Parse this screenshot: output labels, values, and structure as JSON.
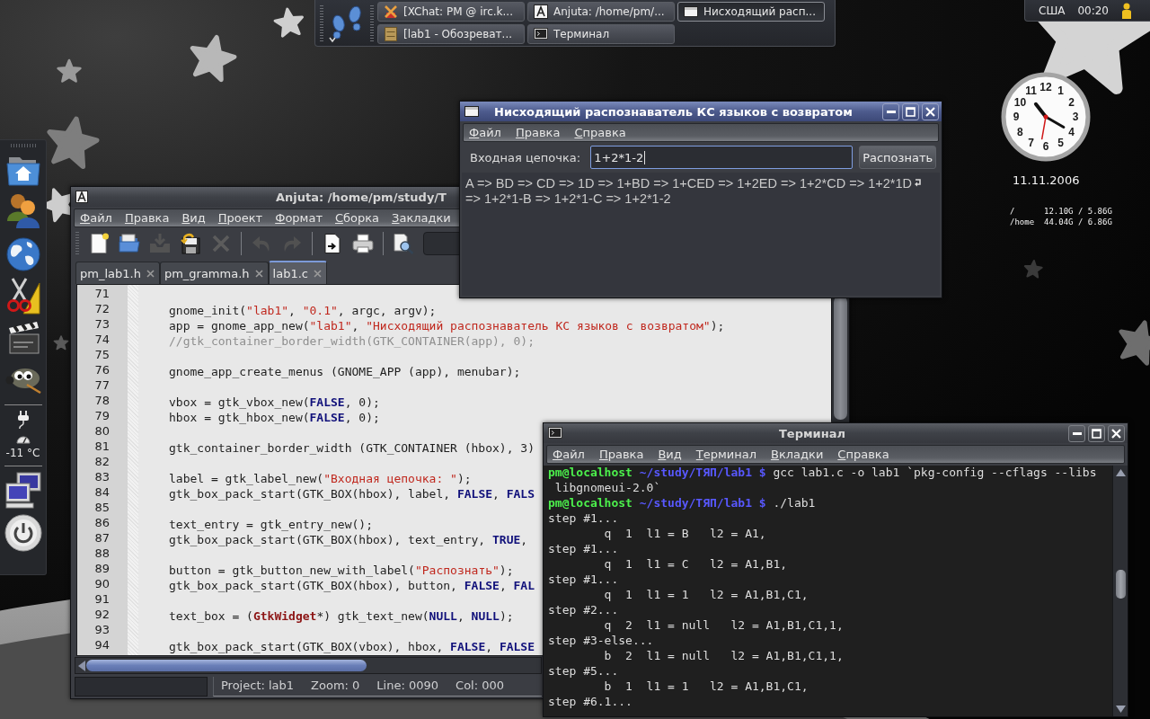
{
  "top_panel": {
    "tasks": [
      {
        "kind": "chat",
        "label": "[XChat: PM @ irc.k...",
        "selected": false
      },
      {
        "kind": "ide",
        "label": "Anjuta: /home/pm/...",
        "selected": false
      },
      {
        "kind": "dialog",
        "label": "Нисходящий расп...",
        "selected": true
      },
      {
        "kind": "file-manager",
        "label": "[lab1 - Обозреват...",
        "selected": false
      },
      {
        "kind": "terminal",
        "label": "Терминал",
        "selected": false
      }
    ]
  },
  "tray": {
    "layout": "США",
    "time": "00:20"
  },
  "desktop": {
    "clock": {
      "numerals": [
        "12",
        "11",
        "1",
        "10",
        "2",
        "9",
        "3",
        "8",
        "4",
        "7",
        "5",
        "6"
      ]
    },
    "date": "11.11.2006",
    "disks": [
      {
        "mount": "/",
        "usage": "12.10G / 5.86G"
      },
      {
        "mount": "/home",
        "usage": "44.04G / 6.86G"
      }
    ]
  },
  "dock": {
    "temperature": "-11 °C"
  },
  "anjuta_window": {
    "title": "Anjuta: /home/pm/study/Т",
    "focused": false,
    "menu": [
      "Файл",
      "Правка",
      "Вид",
      "Проект",
      "Формат",
      "Сборка",
      "Закладки"
    ],
    "toolbar": [
      [
        {
          "kind": "new",
          "disabled": false
        },
        {
          "kind": "open",
          "disabled": false
        },
        {
          "kind": "save",
          "disabled": true
        },
        {
          "kind": "revert",
          "disabled": false
        },
        {
          "kind": "close",
          "disabled": true
        }
      ],
      [
        {
          "kind": "undo",
          "disabled": true
        },
        {
          "kind": "redo",
          "disabled": true
        }
      ],
      [
        {
          "kind": "jump",
          "disabled": false
        },
        {
          "kind": "print",
          "disabled": false
        }
      ],
      [
        {
          "kind": "find",
          "disabled": false
        }
      ]
    ],
    "tabs": [
      {
        "label": "pm_lab1.h",
        "selected": false
      },
      {
        "label": "pm_gramma.h",
        "selected": false
      },
      {
        "label": "lab1.c",
        "selected": true
      }
    ],
    "editor": {
      "lines": [
        {
          "number": "71"
        },
        {
          "number": "72",
          "code": [
            {
              "kind": "plain",
              "text": "gnome_init("
            },
            {
              "kind": "string",
              "text": "\"lab1\""
            },
            {
              "kind": "plain",
              "text": ", "
            },
            {
              "kind": "string",
              "text": "\"0.1\""
            },
            {
              "kind": "plain",
              "text": ", argc, argv);"
            }
          ]
        },
        {
          "number": "73",
          "code": [
            {
              "kind": "plain",
              "text": "app = gnome_app_new("
            },
            {
              "kind": "string",
              "text": "\"lab1\""
            },
            {
              "kind": "plain",
              "text": ", "
            },
            {
              "kind": "string",
              "text": "\"Нисходящий распознаватель КС языков с возвратом\""
            },
            {
              "kind": "plain",
              "text": ");"
            }
          ]
        },
        {
          "number": "74",
          "code": [
            {
              "kind": "comment",
              "text": "//gtk_container_border_width(GTK_CONTAINER(app), 0);"
            }
          ]
        },
        {
          "number": "75"
        },
        {
          "number": "76",
          "code": [
            {
              "kind": "plain",
              "text": "gnome_app_create_menus (GNOME_APP (app), menubar);"
            }
          ]
        },
        {
          "number": "77"
        },
        {
          "number": "78",
          "code": [
            {
              "kind": "plain",
              "text": "vbox = gtk_vbox_new("
            },
            {
              "kind": "keyword",
              "text": "FALSE"
            },
            {
              "kind": "plain",
              "text": ", 0);"
            }
          ]
        },
        {
          "number": "79",
          "code": [
            {
              "kind": "plain",
              "text": "hbox = gtk_hbox_new("
            },
            {
              "kind": "keyword",
              "text": "FALSE"
            },
            {
              "kind": "plain",
              "text": ", 0);"
            }
          ]
        },
        {
          "number": "80"
        },
        {
          "number": "81",
          "code": [
            {
              "kind": "plain",
              "text": "gtk_container_border_width (GTK_CONTAINER (hbox), 3)"
            }
          ]
        },
        {
          "number": "82"
        },
        {
          "number": "83",
          "code": [
            {
              "kind": "plain",
              "text": "label = gtk_label_new("
            },
            {
              "kind": "string",
              "text": "\"Входная цепочка: \""
            },
            {
              "kind": "plain",
              "text": ");"
            }
          ]
        },
        {
          "number": "84",
          "code": [
            {
              "kind": "plain",
              "text": "gtk_box_pack_start(GTK_BOX(hbox), label, "
            },
            {
              "kind": "keyword",
              "text": "FALSE"
            },
            {
              "kind": "plain",
              "text": ", "
            },
            {
              "kind": "keyword",
              "text": "FALS"
            }
          ]
        },
        {
          "number": "85"
        },
        {
          "number": "86",
          "code": [
            {
              "kind": "plain",
              "text": "text_entry = gtk_entry_new();"
            }
          ]
        },
        {
          "number": "87",
          "code": [
            {
              "kind": "plain",
              "text": "gtk_box_pack_start(GTK_BOX(hbox), text_entry, "
            },
            {
              "kind": "keyword",
              "text": "TRUE"
            },
            {
              "kind": "plain",
              "text": ","
            }
          ]
        },
        {
          "number": "88"
        },
        {
          "number": "89",
          "code": [
            {
              "kind": "plain",
              "text": "button = gtk_button_new_with_label("
            },
            {
              "kind": "string",
              "text": "\"Распознать\""
            },
            {
              "kind": "plain",
              "text": ");"
            }
          ]
        },
        {
          "number": "90",
          "code": [
            {
              "kind": "plain",
              "text": "gtk_box_pack_start(GTK_BOX(hbox), button, "
            },
            {
              "kind": "keyword",
              "text": "FALSE"
            },
            {
              "kind": "plain",
              "text": ", "
            },
            {
              "kind": "keyword",
              "text": "FAL"
            }
          ]
        },
        {
          "number": "91"
        },
        {
          "number": "92",
          "code": [
            {
              "kind": "plain",
              "text": "text_box = ("
            },
            {
              "kind": "type",
              "text": "GtkWidget"
            },
            {
              "kind": "plain",
              "text": "*) gtk_text_new("
            },
            {
              "kind": "keyword",
              "text": "NULL"
            },
            {
              "kind": "plain",
              "text": ", "
            },
            {
              "kind": "keyword",
              "text": "NULL"
            },
            {
              "kind": "plain",
              "text": ");"
            }
          ]
        },
        {
          "number": "93"
        },
        {
          "number": "94",
          "code": [
            {
              "kind": "plain",
              "text": "gtk_box_pack_start(GTK_BOX(vbox), hbox, "
            },
            {
              "kind": "keyword",
              "text": "FALSE"
            },
            {
              "kind": "plain",
              "text": ", "
            },
            {
              "kind": "keyword",
              "text": "FALSE"
            }
          ]
        }
      ]
    },
    "status_bar": [
      "Project: lab1",
      "Zoom: 0",
      "Line: 0090",
      "Col: 000"
    ]
  },
  "recognizer_window": {
    "title": "Нисходящий распознаватель КС языков с возвратом",
    "focused": true,
    "menu": [
      "Файл",
      "Правка",
      "Справка"
    ],
    "input_label": "Входная цепочка:",
    "input_value": "1+2*1-2",
    "button": "Распознать",
    "output_lines": [
      {
        "text": "A => BD => CD => 1D => 1+BD => 1+CED => 1+2ED => 1+2*CD => 1+2*1D",
        "wrapped": true
      },
      {
        "text": "=> 1+2*1-B => 1+2*1-C => 1+2*1-2",
        "wrapped": false
      }
    ]
  },
  "terminal_window": {
    "title": "Терминал",
    "focused": false,
    "menu": [
      "Файл",
      "Правка",
      "Вид",
      "Терминал",
      "Вкладки",
      "Справка"
    ],
    "lines": [
      {
        "kind": "prompt",
        "user": "pm@localhost",
        "path": "~/study/ТЯП/lab1 $",
        "command": "gcc lab1.c -o lab1 `pkg-config --cflags --libs"
      },
      {
        "kind": "continuation",
        "text": "libgnomeui-2.0`"
      },
      {
        "kind": "prompt",
        "user": "pm@localhost",
        "path": "~/study/ТЯП/lab1 $",
        "command": "./lab1"
      },
      {
        "kind": "output",
        "text": "step #1..."
      },
      {
        "kind": "detail",
        "text": "q  1  l1 = B   l2 = A1,"
      },
      {
        "kind": "output",
        "text": "step #1..."
      },
      {
        "kind": "detail",
        "text": "q  1  l1 = C   l2 = A1,B1,"
      },
      {
        "kind": "output",
        "text": "step #1..."
      },
      {
        "kind": "detail",
        "text": "q  1  l1 = 1   l2 = A1,B1,C1,"
      },
      {
        "kind": "output",
        "text": "step #2..."
      },
      {
        "kind": "detail",
        "text": "q  2  l1 = null   l2 = A1,B1,C1,1,"
      },
      {
        "kind": "output",
        "text": "step #3-else..."
      },
      {
        "kind": "detail",
        "text": "b  2  l1 = null   l2 = A1,B1,C1,1,"
      },
      {
        "kind": "output",
        "text": "step #5..."
      },
      {
        "kind": "detail",
        "text": "b  1  l1 = 1   l2 = A1,B1,C1,"
      },
      {
        "kind": "output",
        "text": "step #6.1..."
      }
    ]
  }
}
